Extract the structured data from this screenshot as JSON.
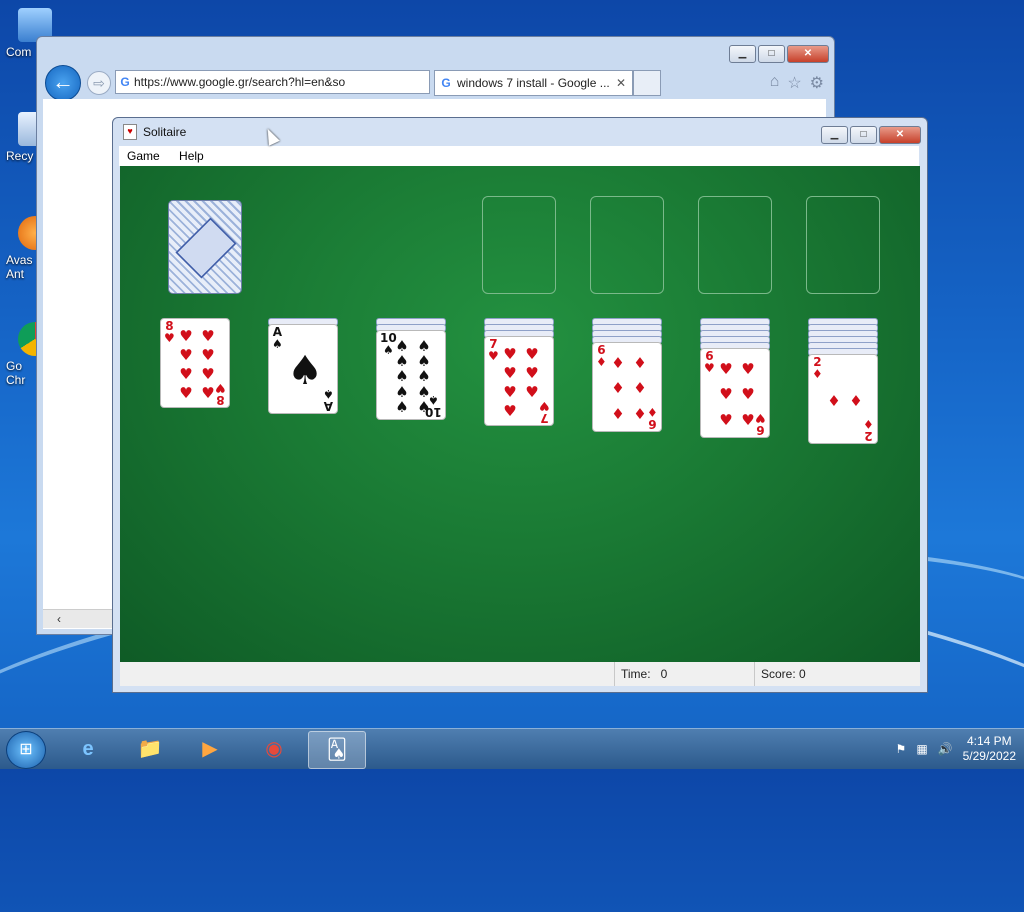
{
  "desktop": {
    "icons": [
      {
        "label": "Com",
        "icon": "computer-icon"
      },
      {
        "label": "Recy",
        "icon": "recycle-bin-icon"
      },
      {
        "label": "Avas",
        "label2": "Ant",
        "icon": "avast-icon"
      },
      {
        "label": "Go",
        "label2": "Chr",
        "icon": "chrome-icon"
      }
    ]
  },
  "browser": {
    "url": "https://www.google.gr/search?hl=en&so",
    "tab_title": "windows 7 install - Google ...",
    "tab_close": "✕",
    "back": "←",
    "forward": "⇨"
  },
  "solitaire": {
    "title": "Solitaire",
    "menu": {
      "game": "Game",
      "help": "Help"
    },
    "status": {
      "time_label": "Time:",
      "time_value": "0",
      "score_label": "Score:",
      "score_value": "0"
    },
    "tableau": [
      {
        "rank": "8",
        "suit": "♥",
        "color": "red",
        "hidden": 0
      },
      {
        "rank": "A",
        "suit": "♠",
        "color": "blk",
        "hidden": 1
      },
      {
        "rank": "10",
        "suit": "♠",
        "color": "blk",
        "hidden": 2
      },
      {
        "rank": "7",
        "suit": "♥",
        "color": "red",
        "hidden": 3
      },
      {
        "rank": "6",
        "suit": "♦",
        "color": "red",
        "hidden": 4
      },
      {
        "rank": "6",
        "suit": "♥",
        "color": "red",
        "hidden": 5
      },
      {
        "rank": "2",
        "suit": "♦",
        "color": "red",
        "hidden": 6
      }
    ]
  },
  "taskbar": {
    "clock_time": "4:14 PM",
    "clock_date": "5/29/2022",
    "apps": [
      {
        "name": "internet-explorer",
        "glyph": "e"
      },
      {
        "name": "file-explorer",
        "glyph": "📁"
      },
      {
        "name": "media-player",
        "glyph": "▶"
      },
      {
        "name": "chrome",
        "glyph": "◉"
      },
      {
        "name": "solitaire",
        "glyph": "🂡"
      }
    ]
  }
}
